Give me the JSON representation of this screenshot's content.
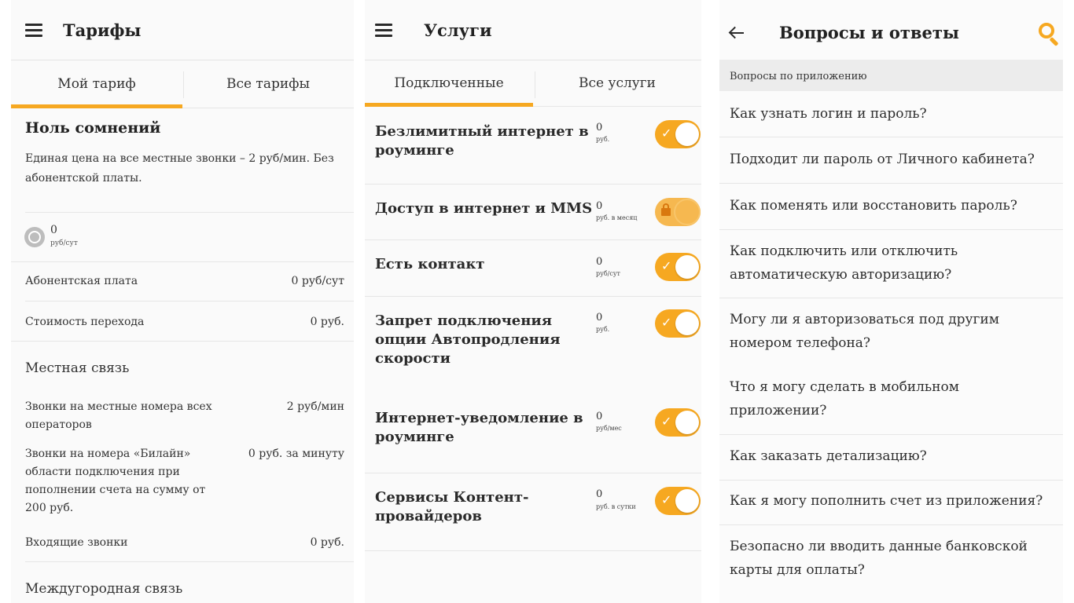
{
  "tariffs_screen": {
    "title": "Тарифы",
    "tabs": [
      "Мой тариф",
      "Все тарифы"
    ],
    "tariff_name": "Ноль сомнений",
    "tariff_description": "Единая цена на все местные звонки – 2 руб/мин. Без абонентской платы.",
    "daily_fee_value": "0",
    "daily_fee_unit": "руб/сут",
    "rows": [
      {
        "label": "Абонентская плата",
        "value": "0 руб/сут"
      },
      {
        "label": "Стоимость перехода",
        "value": "0 руб."
      }
    ],
    "local_section": "Местная связь",
    "local_rows": [
      {
        "label": "Звонки на местные номера всех операторов",
        "value": "2 руб/мин"
      },
      {
        "label": "Звонки на номера «Билайн» области подключения при пополнении счета на сумму от 200 руб.",
        "value": "0 руб. за минуту"
      },
      {
        "label": "Входящие звонки",
        "value": "0 руб."
      }
    ],
    "long_distance_section": "Междугородная связь"
  },
  "services_screen": {
    "title": "Услуги",
    "tabs": [
      "Подключенные",
      "Все услуги"
    ],
    "services": [
      {
        "name": "Безлимитный интернет в роуминге",
        "price": "0",
        "unit": "руб.",
        "state": "on"
      },
      {
        "name": "Доступ в интернет и MMS",
        "price": "0",
        "unit": "руб. в месяц",
        "state": "locked"
      },
      {
        "name": "Есть контакт",
        "price": "0",
        "unit": "руб/сут",
        "state": "on"
      },
      {
        "name": "Запрет подключения опции Автопродления скорости",
        "price": "0",
        "unit": "руб.",
        "state": "on"
      },
      {
        "name": "Интернет-уведомление в роуминге",
        "price": "0",
        "unit": "руб/мес",
        "state": "on"
      },
      {
        "name": "Сервисы Контент-провайдеров",
        "price": "0",
        "unit": "руб. в сутки",
        "state": "on"
      }
    ]
  },
  "faq_screen": {
    "title": "Вопросы и ответы",
    "category": "Вопросы по приложению",
    "questions": [
      "Как узнать логин и пароль?",
      "Подходит ли пароль от Личного кабинета?",
      "Как поменять или восстановить пароль?",
      "Как подключить или отключить автоматическую авторизацию?",
      "Могу ли я авторизоваться под другим номером телефона?",
      "Что я могу сделать в мобильном приложении?",
      "Как заказать детализацию?",
      "Как я могу пополнить счет из приложения?",
      "Безопасно ли вводить данные банковской карты для оплаты?"
    ]
  },
  "colors": {
    "accent": "#f6a821",
    "background": "#fafafa",
    "divider": "#e6e6e6",
    "category_bg": "#ececec"
  },
  "icons": [
    "menu-icon",
    "clock-icon",
    "check-icon",
    "lock-icon",
    "back-arrow-icon",
    "search-icon"
  ]
}
